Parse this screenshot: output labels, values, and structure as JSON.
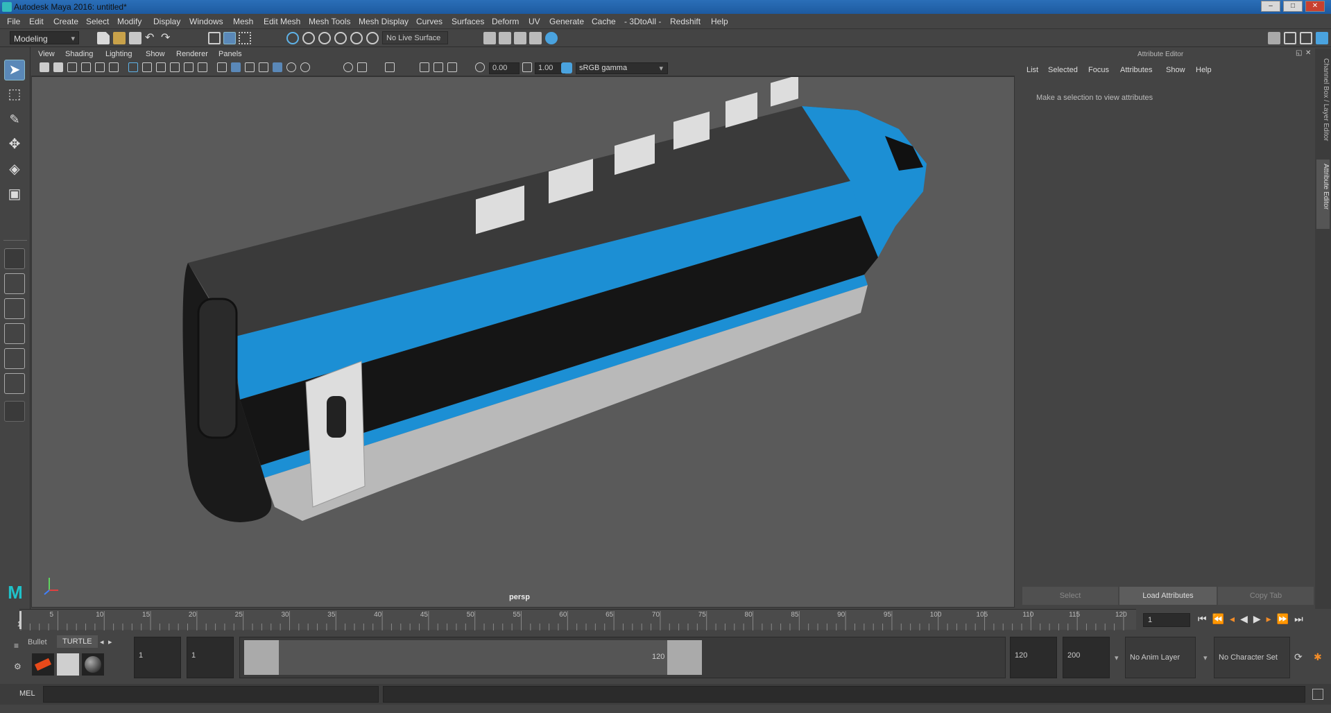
{
  "title": "Autodesk Maya 2016: untitled*",
  "window_controls": [
    "–",
    "□",
    "✕"
  ],
  "menu": [
    "File",
    "Edit",
    "Create",
    "Select",
    "Modify",
    "Display",
    "Windows",
    "Mesh",
    "Edit Mesh",
    "Mesh Tools",
    "Mesh Display",
    "Curves",
    "Surfaces",
    "Deform",
    "UV",
    "Generate",
    "Cache",
    "- 3DtoAll -",
    "Redshift",
    "Help"
  ],
  "status": {
    "mode": "Modeling",
    "live_surface": "No Live Surface"
  },
  "viewport_menu": [
    "View",
    "Shading",
    "Lighting",
    "Show",
    "Renderer",
    "Panels"
  ],
  "viewport_toolbar": {
    "exposure": "0.00",
    "gamma": "1.00",
    "colorspace": "sRGB gamma"
  },
  "viewport": {
    "camera_label": "persp"
  },
  "attribute_editor": {
    "header": "Attribute Editor",
    "tabs": [
      "List",
      "Selected",
      "Focus",
      "Attributes",
      "Show",
      "Help"
    ],
    "message": "Make a selection to view attributes",
    "buttons": {
      "select": "Select",
      "load": "Load Attributes",
      "copy": "Copy Tab"
    }
  },
  "side_tabs": {
    "channel_box": "Channel Box / Layer Editor",
    "attribute_editor": "Attribute Editor"
  },
  "timeline": {
    "ticks": [
      "5",
      "10",
      "15",
      "20",
      "25",
      "30",
      "35",
      "40",
      "45",
      "50",
      "55",
      "60",
      "65",
      "70",
      "75",
      "80",
      "85",
      "90",
      "95",
      "100",
      "105",
      "110",
      "115",
      "120"
    ],
    "start_tick": "1",
    "current_frame": "1"
  },
  "shelf_tabs": [
    "Bullet",
    "TURTLE"
  ],
  "range": {
    "start": "1",
    "anim_start": "1",
    "range_start_label": "1",
    "range_end_label": "120",
    "anim_end": "120",
    "end": "200"
  },
  "anim_layer": "No Anim Layer",
  "character_set": "No Character Set",
  "cmd": {
    "label": "MEL"
  },
  "colors": {
    "accent": "#4aa3df",
    "train_blue": "#1c8fd4",
    "viewport_bg": "#5a5a5a"
  }
}
